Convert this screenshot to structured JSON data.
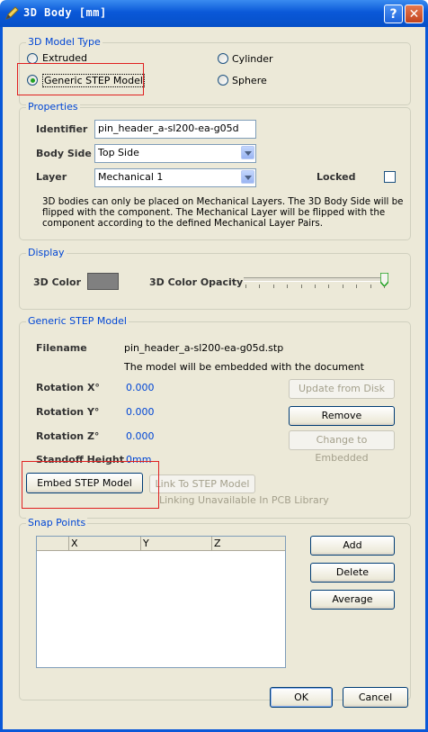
{
  "window": {
    "title": "3D Body [mm]",
    "help_label": "?",
    "close_label": "✕"
  },
  "model_type": {
    "title": "3D Model Type",
    "options": [
      {
        "label": "Extruded",
        "selected": false
      },
      {
        "label": "Cylinder",
        "selected": false
      },
      {
        "label": "Generic STEP Model",
        "selected": true
      },
      {
        "label": "Sphere",
        "selected": false
      }
    ]
  },
  "properties": {
    "title": "Properties",
    "identifier_label": "Identifier",
    "identifier_value": "pin_header_a-sl200-ea-g05d",
    "body_side_label": "Body Side",
    "body_side_value": "Top Side",
    "layer_label": "Layer",
    "layer_value": "Mechanical 1",
    "locked_label": "Locked",
    "locked_checked": false,
    "info_lines": [
      "3D bodies can only be placed on Mechanical Layers. The 3D Body Side will be",
      "flipped with the component. The Mechanical Layer will be flipped with the",
      "component according to the defined Mechanical Layer Pairs."
    ]
  },
  "display": {
    "title": "Display",
    "color_label": "3D Color",
    "color_value": "#808080",
    "opacity_label": "3D Color Opacity",
    "opacity_level": 1.0
  },
  "step_model": {
    "title": "Generic STEP Model",
    "filename_label": "Filename",
    "filename_value": "pin_header_a-sl200-ea-g05d.stp",
    "embed_note": "The model will be embedded with the document",
    "rotation_x_label": "Rotation X°",
    "rotation_x_value": "0.000",
    "rotation_y_label": "Rotation Y°",
    "rotation_y_value": "0.000",
    "rotation_z_label": "Rotation Z°",
    "rotation_z_value": "0.000",
    "standoff_label": "Standoff Height",
    "standoff_value": "0mm",
    "update_button": "Update from Disk",
    "remove_button": "Remove",
    "change_button": "Change to Embedded",
    "embed_button": "Embed STEP Model",
    "link_button": "Link To STEP Model",
    "link_note": "Linking Unavailable In PCB Library"
  },
  "snap_points": {
    "title": "Snap Points",
    "columns": [
      "X",
      "Y",
      "Z"
    ],
    "add_button": "Add",
    "delete_button": "Delete",
    "average_button": "Average"
  },
  "footer": {
    "ok_button": "OK",
    "cancel_button": "Cancel"
  }
}
